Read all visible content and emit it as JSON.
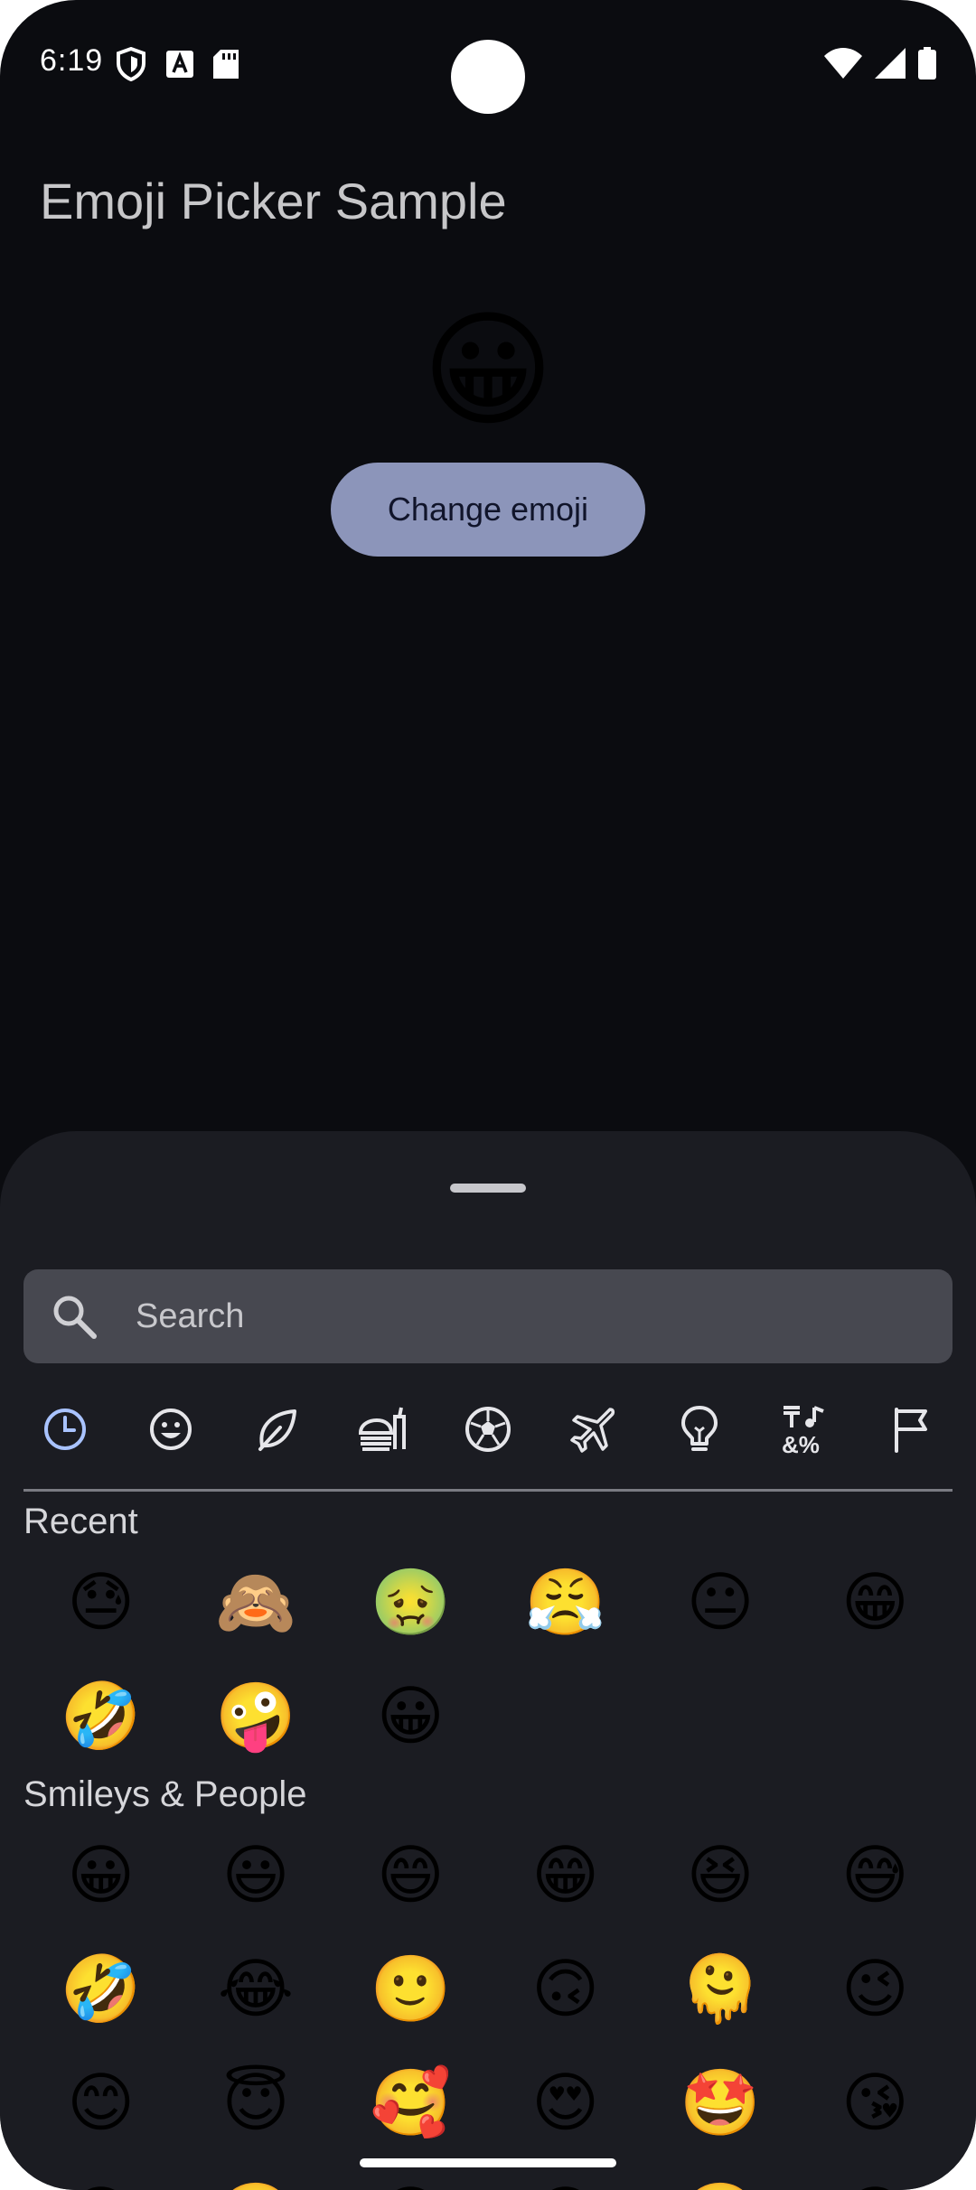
{
  "status_bar": {
    "time": "6:19",
    "left_icons": [
      "shield-icon",
      "text-a-icon",
      "sd-card-icon"
    ],
    "right_icons": [
      "wifi-icon",
      "signal-icon",
      "battery-icon"
    ]
  },
  "app": {
    "title": "Emoji Picker Sample",
    "selected_emoji": "😀",
    "change_button_label": "Change emoji"
  },
  "colors": {
    "background": "#0b0c10",
    "sheet": "#1b1c22",
    "search_bar": "#474850",
    "button": "#8c95ba",
    "active_tab": "#a9c3ff"
  },
  "picker": {
    "search_placeholder": "Search",
    "categories": [
      {
        "name": "recent",
        "icon": "clock-icon",
        "active": true
      },
      {
        "name": "smileys",
        "icon": "smiley-icon",
        "active": false
      },
      {
        "name": "nature",
        "icon": "leaf-icon",
        "active": false
      },
      {
        "name": "food",
        "icon": "food-icon",
        "active": false
      },
      {
        "name": "activities",
        "icon": "soccer-ball-icon",
        "active": false
      },
      {
        "name": "travel",
        "icon": "airplane-icon",
        "active": false
      },
      {
        "name": "objects",
        "icon": "lightbulb-icon",
        "active": false
      },
      {
        "name": "symbols",
        "icon": "symbols-icon",
        "active": false
      },
      {
        "name": "flags",
        "icon": "flag-icon",
        "active": false
      }
    ],
    "sections": [
      {
        "label": "Recent",
        "emojis": [
          "😓",
          "🙈",
          "🤢",
          "😤",
          "😐",
          "😁",
          "🤣",
          "🤪",
          "😀"
        ]
      },
      {
        "label": "Smileys & People",
        "emojis": [
          "😀",
          "😃",
          "😄",
          "😁",
          "😆",
          "😅",
          "🤣",
          "😂",
          "🙂",
          "🙃",
          "🫠",
          "😉",
          "😊",
          "😇",
          "🥰",
          "😍",
          "🤩",
          "😘",
          "😗",
          "☺️",
          "😚",
          "😙",
          "🥲",
          "😋"
        ]
      }
    ]
  }
}
